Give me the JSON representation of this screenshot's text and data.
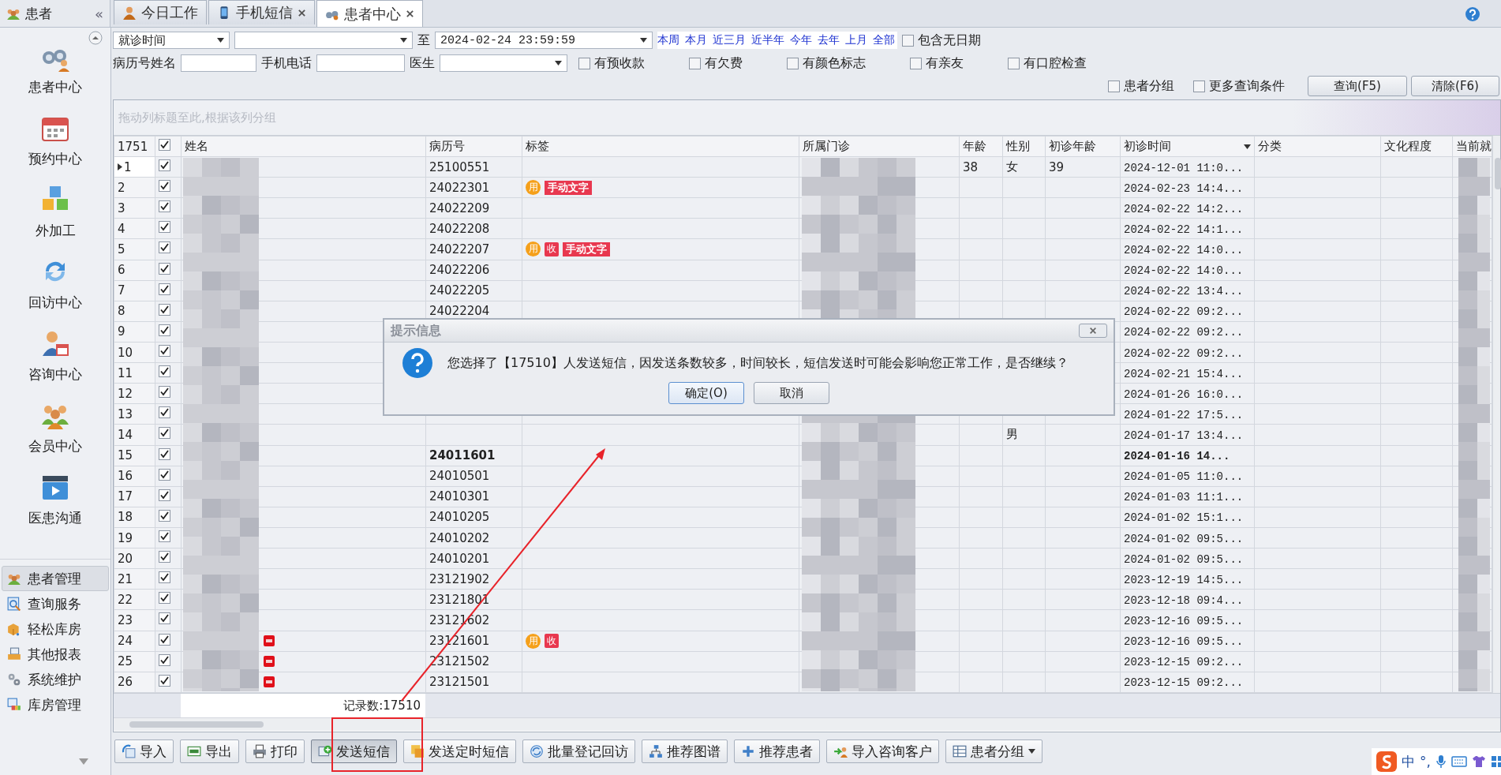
{
  "panel": {
    "title": "患者",
    "collapse": "«"
  },
  "tabs": [
    {
      "label": "今日工作",
      "closable": false,
      "selected": false
    },
    {
      "label": "手机短信",
      "closable": true,
      "selected": false
    },
    {
      "label": "患者中心",
      "closable": true,
      "selected": true
    }
  ],
  "nav": [
    {
      "label": "患者中心"
    },
    {
      "label": "预约中心"
    },
    {
      "label": "外加工"
    },
    {
      "label": "回访中心"
    },
    {
      "label": "咨询中心"
    },
    {
      "label": "会员中心"
    },
    {
      "label": "医患沟通"
    }
  ],
  "modules": [
    {
      "label": "患者管理",
      "selected": true
    },
    {
      "label": "查询服务",
      "selected": false
    },
    {
      "label": "轻松库房",
      "selected": false
    },
    {
      "label": "其他报表",
      "selected": false
    },
    {
      "label": "系统维护",
      "selected": false
    },
    {
      "label": "库房管理",
      "selected": false
    }
  ],
  "filters": {
    "date_field": "就诊时间",
    "to_label": "至",
    "date_to": "2024-02-24 23:59:59",
    "quick_ranges": [
      "本周",
      "本月",
      "近三月",
      "近半年",
      "今年",
      "去年",
      "上月",
      "全部"
    ],
    "include_no_date": {
      "label": "包含无日期",
      "checked": false
    },
    "record_label": "病历号姓名",
    "phone_label": "手机电话",
    "doctor_label": "医生",
    "flags": [
      {
        "label": "有预收款",
        "checked": false
      },
      {
        "label": "有欠费",
        "checked": false
      },
      {
        "label": "有颜色标志",
        "checked": false
      },
      {
        "label": "有亲友",
        "checked": false
      },
      {
        "label": "有口腔检查",
        "checked": false
      }
    ],
    "options": [
      {
        "label": "患者分组",
        "checked": false
      },
      {
        "label": "更多查询条件",
        "checked": false
      }
    ],
    "buttons": [
      "查询(F5)",
      "清除(F6)"
    ]
  },
  "grid": {
    "group_hint": "拖动列标题至此,根据该列分组",
    "columns": [
      {
        "kind": "count",
        "label": "1751"
      },
      {
        "kind": "select",
        "checked": true
      },
      {
        "kind": "text",
        "label": "姓名",
        "sorted": false
      },
      {
        "kind": "text",
        "label": "病历号",
        "sorted": false
      },
      {
        "kind": "text",
        "label": "标签",
        "sorted": false
      },
      {
        "kind": "text",
        "label": "所属门诊",
        "sorted": false
      },
      {
        "kind": "text",
        "label": "年龄",
        "sorted": false
      },
      {
        "kind": "text",
        "label": "性别",
        "sorted": false
      },
      {
        "kind": "text",
        "label": "初诊年龄",
        "sorted": false
      },
      {
        "kind": "text",
        "label": "初诊时间",
        "sorted": true
      },
      {
        "kind": "text",
        "label": "分类",
        "sorted": false
      },
      {
        "kind": "text",
        "label": "文化程度",
        "sorted": false
      },
      {
        "kind": "text",
        "label": "当前就"
      }
    ],
    "rows": [
      {
        "no": "1",
        "current": true,
        "checked": true,
        "bold": false,
        "vip": false,
        "record": "25100551",
        "age": "38",
        "sex": "女",
        "first_age": "39",
        "first_time": "2024-12-01 11:0..."
      },
      {
        "no": "2",
        "current": false,
        "checked": true,
        "bold": false,
        "vip": false,
        "record": "24022301",
        "tags": [
          {
            "text": "用",
            "kind": "round",
            "color": "#f5a01a"
          },
          {
            "text": "手动文字",
            "kind": "label",
            "color": "#e8384f"
          }
        ],
        "first_time": "2024-02-23 14:4..."
      },
      {
        "no": "3",
        "current": false,
        "checked": true,
        "bold": false,
        "vip": false,
        "record": "24022209",
        "first_time": "2024-02-22 14:2..."
      },
      {
        "no": "4",
        "current": false,
        "checked": true,
        "bold": false,
        "vip": false,
        "record": "24022208",
        "first_time": "2024-02-22 14:1..."
      },
      {
        "no": "5",
        "current": false,
        "checked": true,
        "bold": false,
        "vip": false,
        "record": "24022207",
        "tags": [
          {
            "text": "用",
            "kind": "round",
            "color": "#f5a01a"
          },
          {
            "text": "收",
            "kind": "square",
            "color": "#e8384f"
          },
          {
            "text": "手动文字",
            "kind": "label",
            "color": "#e8384f"
          }
        ],
        "first_time": "2024-02-22 14:0..."
      },
      {
        "no": "6",
        "current": false,
        "checked": true,
        "bold": false,
        "vip": false,
        "record": "24022206",
        "first_time": "2024-02-22 14:0..."
      },
      {
        "no": "7",
        "current": false,
        "checked": true,
        "bold": false,
        "vip": false,
        "record": "24022205",
        "first_time": "2024-02-22 13:4..."
      },
      {
        "no": "8",
        "current": false,
        "checked": true,
        "bold": false,
        "vip": false,
        "record": "24022204",
        "first_time": "2024-02-22 09:2..."
      },
      {
        "no": "9",
        "current": false,
        "checked": true,
        "bold": false,
        "vip": false,
        "first_time": "2024-02-22 09:2..."
      },
      {
        "no": "10",
        "current": false,
        "checked": true,
        "bold": false,
        "vip": false,
        "first_time": "2024-02-22 09:2..."
      },
      {
        "no": "11",
        "current": false,
        "checked": true,
        "bold": false,
        "vip": false,
        "first_time": "2024-02-21 15:4..."
      },
      {
        "no": "12",
        "current": false,
        "checked": true,
        "bold": false,
        "vip": false,
        "first_time": "2024-01-26 16:0..."
      },
      {
        "no": "13",
        "current": false,
        "checked": true,
        "bold": false,
        "vip": false,
        "first_time": "2024-01-22 17:5..."
      },
      {
        "no": "14",
        "current": false,
        "checked": true,
        "bold": false,
        "vip": false,
        "sex": "男",
        "first_time": "2024-01-17 13:4..."
      },
      {
        "no": "15",
        "current": false,
        "checked": true,
        "bold": true,
        "vip": false,
        "record": "24011601",
        "first_time": "2024-01-16 14..."
      },
      {
        "no": "16",
        "current": false,
        "checked": true,
        "bold": false,
        "vip": false,
        "record": "24010501",
        "first_time": "2024-01-05 11:0..."
      },
      {
        "no": "17",
        "current": false,
        "checked": true,
        "bold": false,
        "vip": false,
        "record": "24010301",
        "first_time": "2024-01-03 11:1..."
      },
      {
        "no": "18",
        "current": false,
        "checked": true,
        "bold": false,
        "vip": false,
        "record": "24010205",
        "first_time": "2024-01-02 15:1..."
      },
      {
        "no": "19",
        "current": false,
        "checked": true,
        "bold": false,
        "vip": false,
        "record": "24010202",
        "first_time": "2024-01-02 09:5..."
      },
      {
        "no": "20",
        "current": false,
        "checked": true,
        "bold": false,
        "vip": false,
        "record": "24010201",
        "first_time": "2024-01-02 09:5..."
      },
      {
        "no": "21",
        "current": false,
        "checked": true,
        "bold": false,
        "vip": false,
        "record": "23121902",
        "first_time": "2023-12-19 14:5..."
      },
      {
        "no": "22",
        "current": false,
        "checked": true,
        "bold": false,
        "vip": false,
        "record": "23121801",
        "first_time": "2023-12-18 09:4..."
      },
      {
        "no": "23",
        "current": false,
        "checked": true,
        "bold": false,
        "vip": false,
        "record": "23121602",
        "first_time": "2023-12-16 09:5..."
      },
      {
        "no": "24",
        "current": false,
        "checked": true,
        "bold": false,
        "vip": true,
        "record": "23121601",
        "tags": [
          {
            "text": "用",
            "kind": "round",
            "color": "#f5a01a"
          },
          {
            "text": "收",
            "kind": "square",
            "color": "#e8384f"
          }
        ],
        "first_time": "2023-12-16 09:5..."
      },
      {
        "no": "25",
        "current": false,
        "checked": true,
        "bold": false,
        "vip": true,
        "record": "23121502",
        "first_time": "2023-12-15 09:2..."
      },
      {
        "no": "26",
        "current": false,
        "checked": true,
        "bold": false,
        "vip": true,
        "record": "23121501",
        "first_time": "2023-12-15 09:2..."
      }
    ],
    "record_count": "记录数:17510"
  },
  "toolbar": [
    {
      "label": "导入",
      "pressed": false,
      "dropdown": false
    },
    {
      "label": "导出",
      "pressed": false,
      "dropdown": false
    },
    {
      "label": "打印",
      "pressed": false,
      "dropdown": false
    },
    {
      "label": "发送短信",
      "pressed": true,
      "dropdown": false
    },
    {
      "label": "发送定时短信",
      "pressed": false,
      "dropdown": false
    },
    {
      "label": "批量登记回访",
      "pressed": false,
      "dropdown": false
    },
    {
      "label": "推荐图谱",
      "pressed": false,
      "dropdown": false
    },
    {
      "label": "推荐患者",
      "pressed": false,
      "dropdown": false
    },
    {
      "label": "导入咨询客户",
      "pressed": false,
      "dropdown": false
    },
    {
      "label": "患者分组",
      "pressed": false,
      "dropdown": true
    }
  ],
  "dialog": {
    "title": "提示信息",
    "message": "您选择了【17510】人发送短信，因发送条数较多，时间较长，短信发送时可能会影响您正常工作，是否继续？",
    "buttons": [
      {
        "label": "确定(O)",
        "focused": true
      },
      {
        "label": "取消",
        "focused": false
      }
    ]
  },
  "ime": {
    "language": "中",
    "punctuation": "°,"
  }
}
